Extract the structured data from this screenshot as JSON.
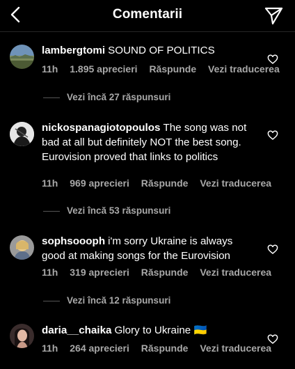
{
  "header": {
    "title": "Comentarii",
    "back_icon": "chevron-left-icon",
    "share_icon": "paper-plane-icon"
  },
  "comments": [
    {
      "username": "lambergtomi",
      "text": "SOUND OF POLITICS",
      "time": "11h",
      "likes": "1.895 aprecieri",
      "reply": "Răspunde",
      "translate": "Vezi traducerea",
      "more_replies": "Vezi încă 27 răspunsuri"
    },
    {
      "username": "nickospanagiotopoulos",
      "text": "The song was not bad at all but definitely NOT the best song. Eurovision proved that links to politics",
      "time": "11h",
      "likes": "969 aprecieri",
      "reply": "Răspunde",
      "translate": "Vezi traducerea",
      "more_replies": "Vezi încă 53 răspunsuri"
    },
    {
      "username": "sophsoooph",
      "text": "i'm sorry Ukraine is always good at making songs for the Eurovision",
      "time": "11h",
      "likes": "319 aprecieri",
      "reply": "Răspunde",
      "translate": "Vezi traducerea",
      "more_replies": "Vezi încă 12 răspunsuri"
    },
    {
      "username": "daria__chaika",
      "text": "Glory to Ukraine",
      "flag": "🇺🇦",
      "time": "11h",
      "likes": "264 aprecieri",
      "reply": "Răspunde",
      "translate": "Vezi traducerea"
    }
  ],
  "colors": {
    "background": "#000000",
    "secondary_text": "#a8a8a8",
    "divider": "#262626"
  }
}
